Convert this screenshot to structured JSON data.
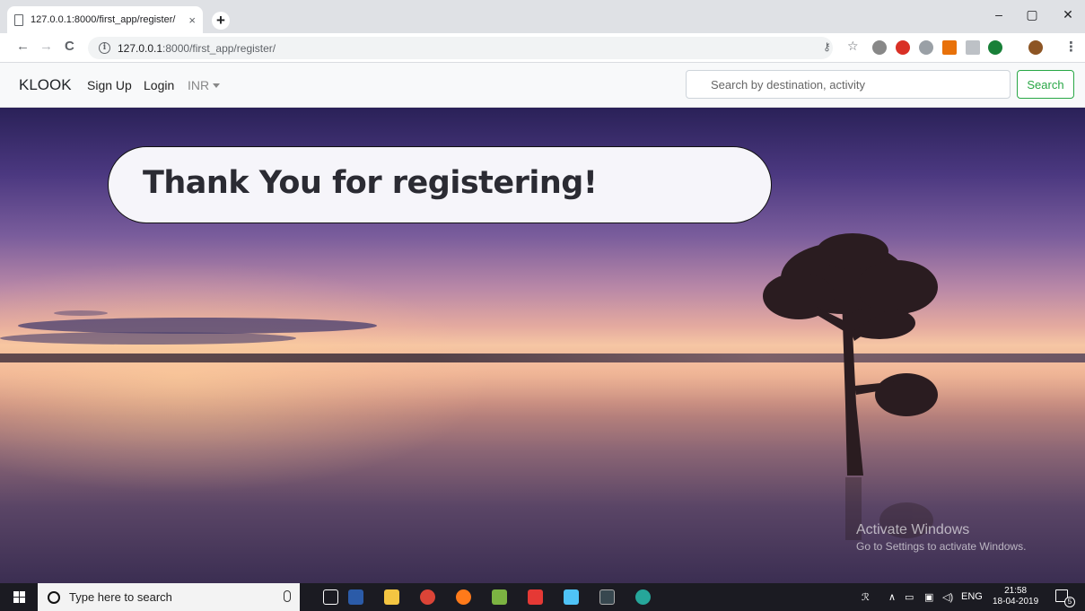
{
  "browser": {
    "tab_title": "127.0.0.1:8000/first_app/register/",
    "tab_close": "×",
    "new_tab": "+",
    "window_controls": {
      "minimize": "–",
      "maximize": "▢",
      "close": "✕"
    },
    "nav": {
      "back": "←",
      "forward": "→",
      "reload": "C"
    },
    "url_host": "127.0.0.1",
    "url_path": ":8000/first_app/register/"
  },
  "site": {
    "brand": "KLOOK",
    "links": {
      "signup": "Sign Up",
      "login": "Login",
      "currency": "INR"
    },
    "search": {
      "placeholder": "Search by destination, activity",
      "button": "Search"
    },
    "accent_color": "#28a745"
  },
  "hero": {
    "message": "Thank You for registering!"
  },
  "watermark": {
    "title": "Activate Windows",
    "subtitle": "Go to Settings to activate Windows."
  },
  "taskbar": {
    "search_placeholder": "Type here to search",
    "language": "ENG",
    "time": "21:58",
    "date": "18-04-2019",
    "notification_count": "5"
  }
}
